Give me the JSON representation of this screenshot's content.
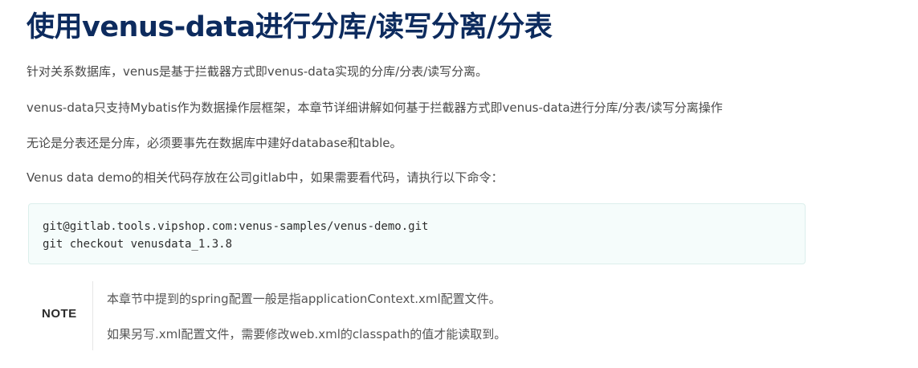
{
  "doc": {
    "title": "使用venus-data进行分库/读写分离/分表",
    "paragraphs": [
      "针对关系数据库，venus是基于拦截器方式即venus-data实现的分库/分表/读写分离。",
      "venus-data只支持Mybatis作为数据操作层框架，本章节详细讲解如何基于拦截器方式即venus-data进行分库/分表/读写分离操作",
      "无论是分表还是分库，必须要事先在数据库中建好database和table。",
      "Venus data demo的相关代码存放在公司gitlab中，如果需要看代码，请执行以下命令："
    ],
    "code_lines": [
      "git@gitlab.tools.vipshop.com:venus-samples/venus-demo.git",
      "git checkout venusdata_1.3.8"
    ],
    "note": {
      "label": "NOTE",
      "lines": [
        "本章节中提到的spring配置一般是指applicationContext.xml配置文件。",
        "如果另写.xml配置文件，需要修改web.xml的classpath的值才能读取到。"
      ]
    }
  },
  "colors": {
    "title": "#0d2b5e",
    "body_text": "#4a4a4a",
    "code_background": "#f5fcfb",
    "code_border": "#dcefec"
  }
}
